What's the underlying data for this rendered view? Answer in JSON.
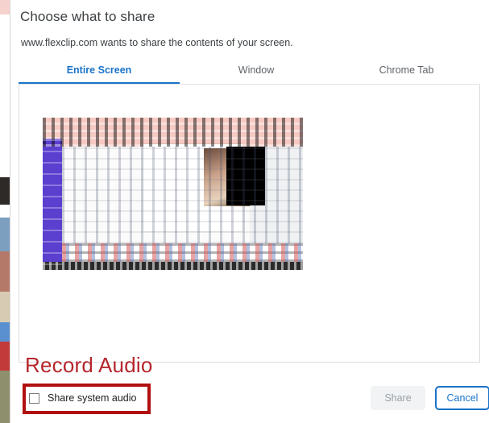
{
  "dialog": {
    "title": "Choose what to share",
    "subtitle": "www.flexclip.com wants to share the contents of your screen."
  },
  "tabs": [
    {
      "label": "Entire Screen",
      "active": true
    },
    {
      "label": "Window",
      "active": false
    },
    {
      "label": "Chrome Tab",
      "active": false
    }
  ],
  "preview": {
    "thumbnail_name": "entire-screen-preview-thumbnail"
  },
  "annotations": {
    "record_audio_label": "Record Audio",
    "record_audio_color": "#b5272d",
    "highlight_box_color": "#b01010"
  },
  "footer": {
    "share_audio_label": "Share system audio",
    "share_audio_checked": false,
    "share_label": "Share",
    "share_disabled": true,
    "cancel_label": "Cancel"
  },
  "colors": {
    "accent_blue": "#1a73c8",
    "disabled_gray": "#9aa0a6",
    "text_dark": "#3c4043"
  }
}
